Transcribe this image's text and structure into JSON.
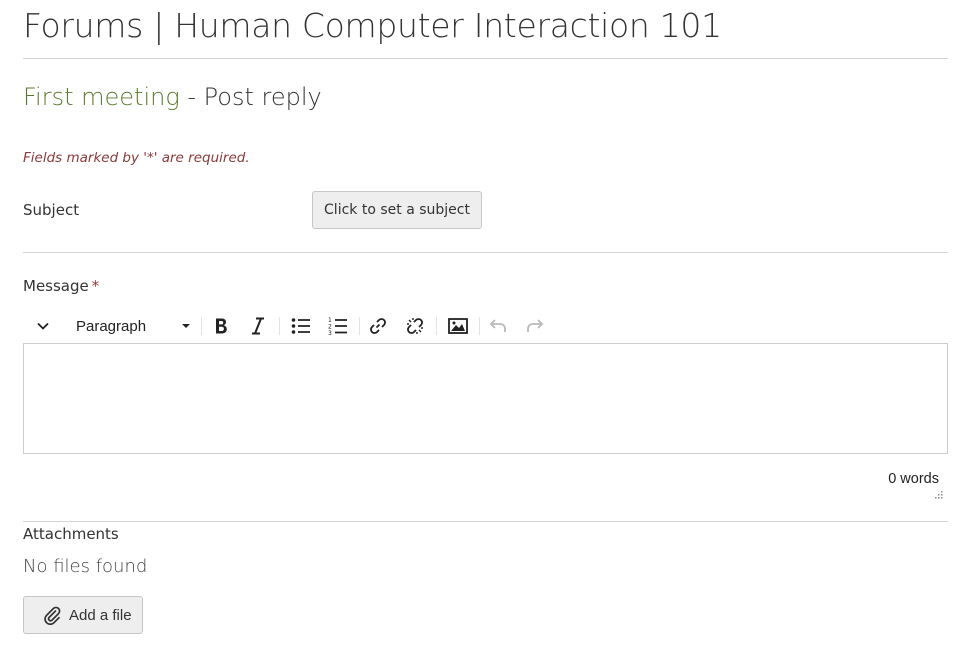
{
  "header": {
    "title": "Forums | Human Computer Interaction 101"
  },
  "subtitle": {
    "discussion_link": "First meeting",
    "rest": " - Post reply"
  },
  "form": {
    "required_note": "Fields marked by '*' are required.",
    "subject": {
      "label": "Subject",
      "button_label": "Click to set a subject"
    },
    "message": {
      "label": "Message",
      "required_marker": "*",
      "editor": {
        "format_value": "Paragraph",
        "toolbar_icons": [
          "collapse-toolbar-icon",
          "bold-icon",
          "italic-icon",
          "bullet-list-icon",
          "numbered-list-icon",
          "link-icon",
          "unlink-icon",
          "image-icon",
          "undo-icon",
          "redo-icon"
        ],
        "content": "",
        "word_count": "0 words"
      }
    },
    "attachments": {
      "label": "Attachments",
      "status": "No files found",
      "add_button_label": "Add a file"
    }
  },
  "colors": {
    "link_green": "#5c7a2e",
    "required_red": "#8b3a3a",
    "button_bg": "#eeeeee"
  }
}
